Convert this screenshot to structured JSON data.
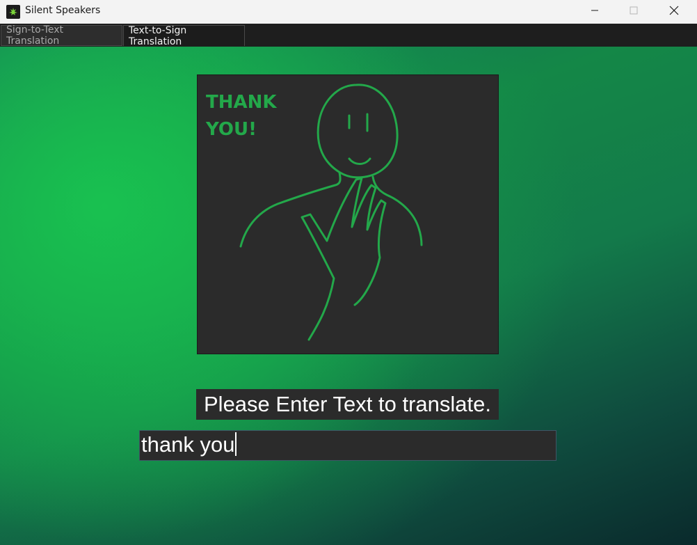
{
  "window": {
    "title": "Silent Speakers",
    "app_icon": "leaf-icon",
    "controls": [
      "minimize-icon",
      "maximize-icon",
      "close-icon"
    ]
  },
  "tabs": [
    {
      "label": "Sign-to-Text Translation",
      "selected": false
    },
    {
      "label": "Text-to-Sign Translation",
      "selected": true
    }
  ],
  "sign_image": {
    "caption_line1": "THANK",
    "caption_line2": "YOU!",
    "stroke_color": "#23a84a",
    "background_color": "#2b2b2b"
  },
  "prompt": {
    "label": "Please Enter Text to translate."
  },
  "input": {
    "value": "thank you"
  },
  "colors": {
    "accent_green": "#19c150",
    "panel_bg": "#2b2b2b"
  }
}
